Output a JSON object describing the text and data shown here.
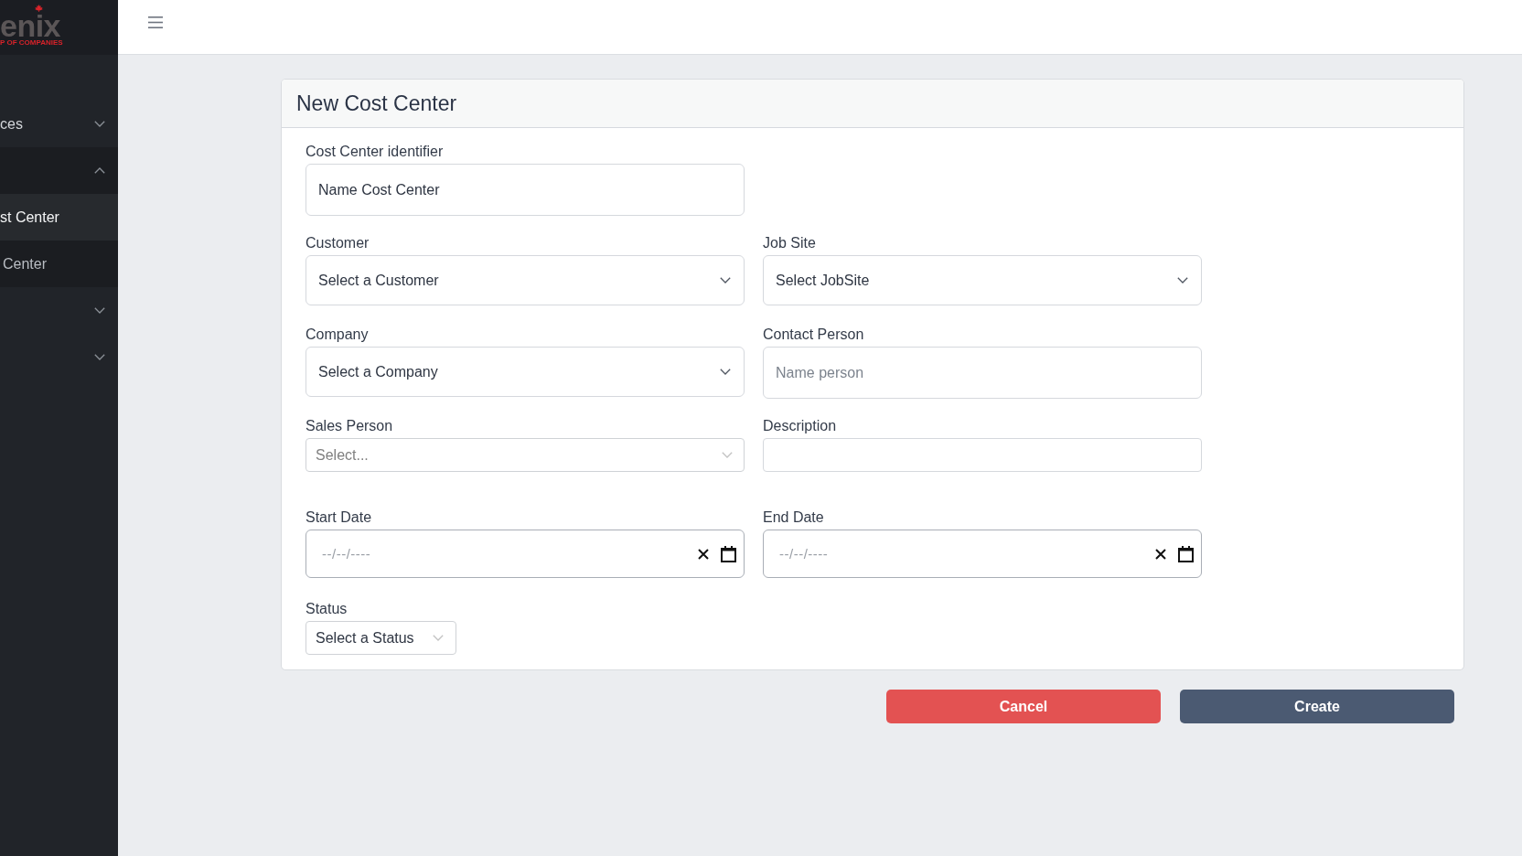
{
  "sidebar": {
    "logo": {
      "wordmark": "enix",
      "tagline": "P OF COMPANIES"
    },
    "items": [
      {
        "label": "ces",
        "expanded": false
      },
      {
        "expanded": true,
        "children": [
          {
            "label": "st Center",
            "selected": true
          },
          {
            "label": "Center",
            "selected": false
          }
        ]
      },
      {
        "expanded": false
      },
      {
        "expanded": false
      }
    ]
  },
  "form": {
    "title": "New Cost Center",
    "rows": [
      [
        {
          "kind": "text",
          "label": "Cost Center identifier",
          "value": "Name Cost Center"
        }
      ],
      [
        {
          "kind": "select",
          "label": "Customer",
          "value": "Select a Customer"
        },
        {
          "kind": "select",
          "label": "Job Site",
          "value": "Select JobSite"
        }
      ],
      [
        {
          "kind": "select",
          "label": "Company",
          "value": "Select a Company"
        },
        {
          "kind": "text",
          "label": "Contact Person",
          "placeholder": "Name person"
        }
      ],
      [
        {
          "kind": "combo",
          "label": "Sales Person",
          "placeholder": "Select..."
        },
        {
          "kind": "short-text",
          "label": "Description"
        }
      ],
      [
        {
          "kind": "date",
          "label": "Start Date",
          "placeholder": "--/--/----"
        },
        {
          "kind": "date",
          "label": "End Date",
          "placeholder": "--/--/----"
        }
      ],
      [
        {
          "kind": "inline-select",
          "label": "Status",
          "value": "Select a Status"
        }
      ]
    ]
  },
  "buttons": [
    {
      "label": "Cancel",
      "kind": "danger"
    },
    {
      "label": "Create",
      "kind": "primary"
    }
  ]
}
